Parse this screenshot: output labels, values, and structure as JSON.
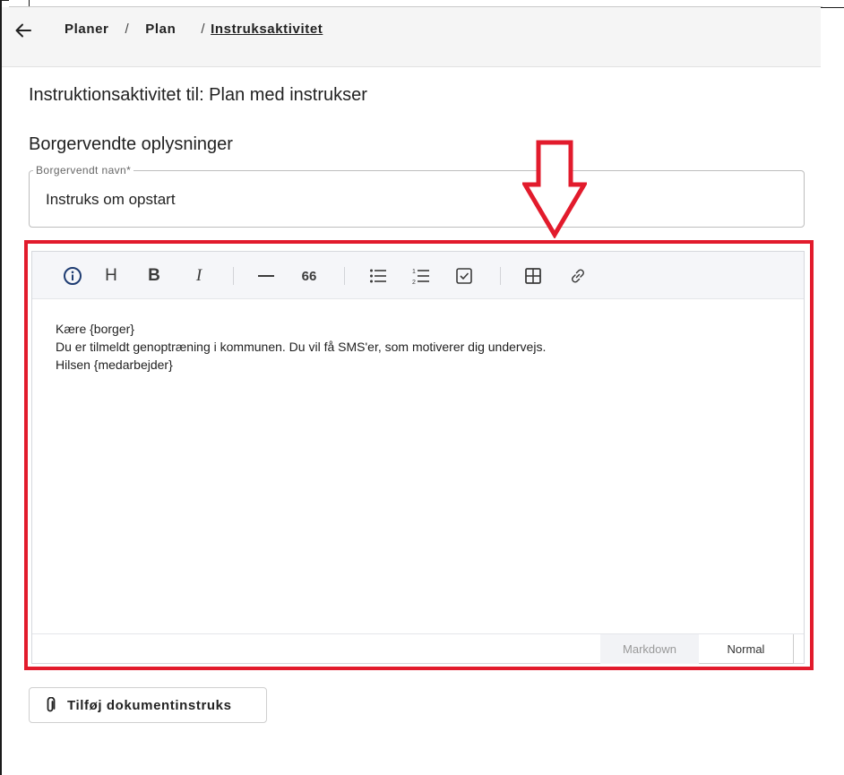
{
  "breadcrumb": {
    "items": [
      "Planer",
      "Plan"
    ],
    "separator": "/",
    "current": "Instruksaktivitet"
  },
  "page": {
    "title": "Instruktionsaktivitet til: Plan med instrukser",
    "section_title": "Borgervendte oplysninger"
  },
  "name_field": {
    "label": "Borgervendt navn*",
    "value": "Instruks om opstart"
  },
  "editor": {
    "toolbar": {
      "heading": "H",
      "bold": "B",
      "italic": "I",
      "quote": "66"
    },
    "icons": [
      "info-icon",
      "heading-icon",
      "bold-icon",
      "italic-icon",
      "horizontal-rule-icon",
      "quote-icon",
      "bullet-list-icon",
      "numbered-list-icon",
      "task-list-icon",
      "table-icon",
      "link-icon"
    ],
    "lines": [
      "Kære {borger}",
      "Du er tilmeldt genoptræning i kommunen. Du vil få SMS'er, som motiverer dig undervejs.",
      "Hilsen {medarbejder}"
    ],
    "modes": {
      "markdown": "Markdown",
      "normal": "Normal",
      "selected": "Normal"
    }
  },
  "actions": {
    "add_document_label": "Tilføj dokumentinstruks"
  },
  "colors": {
    "highlight": "#e21b2c",
    "toolbar_bg": "#f5f6f9",
    "topbar_bg": "#f5f5f5"
  }
}
